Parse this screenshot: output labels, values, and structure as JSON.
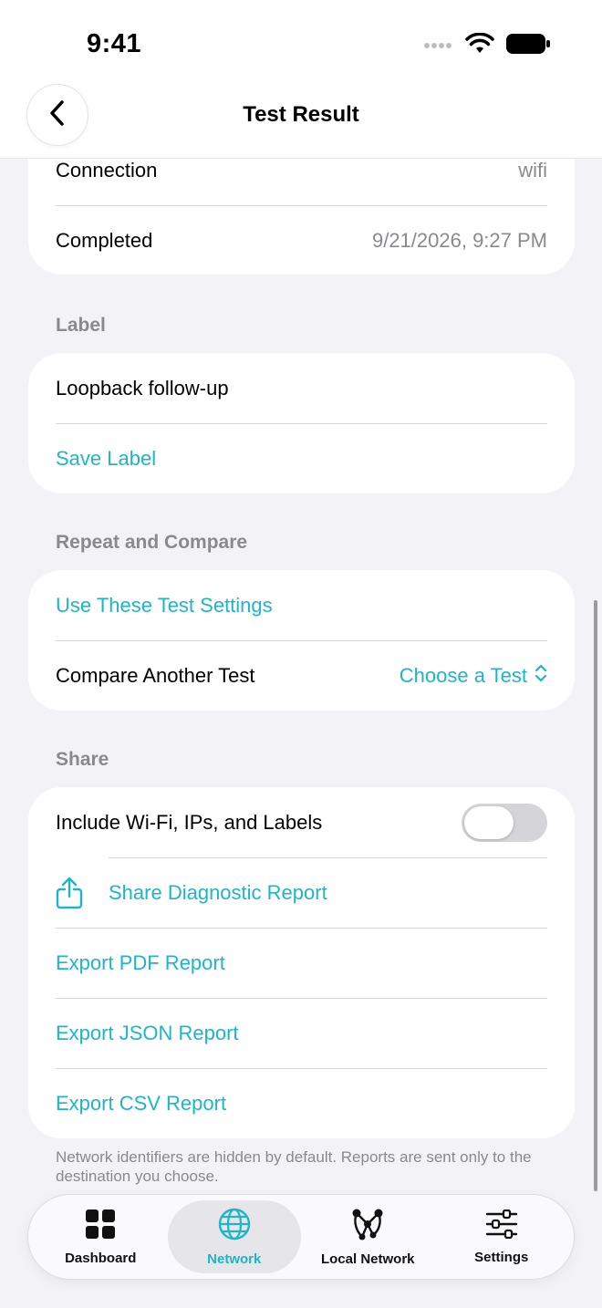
{
  "status": {
    "time": "9:41"
  },
  "nav": {
    "title": "Test Result"
  },
  "details": [
    {
      "label": "Connection",
      "value": "wifi"
    },
    {
      "label": "Completed",
      "value": "9/21/2026, 9:27 PM"
    }
  ],
  "label_section": {
    "header": "Label",
    "field_value": "Loopback follow-up",
    "save_label": "Save Label"
  },
  "repeat_section": {
    "header": "Repeat and Compare",
    "use_settings": "Use These Test Settings",
    "compare_label": "Compare Another Test",
    "compare_picker": "Choose a Test"
  },
  "share_section": {
    "header": "Share",
    "include_label": "Include Wi-Fi, IPs, and Labels",
    "include_on": false,
    "share_report": "Share Diagnostic Report",
    "export_pdf": "Export PDF Report",
    "export_json": "Export JSON Report",
    "export_csv": "Export CSV Report",
    "footnote": "Network identifiers are hidden by default. Reports are sent only to the destination you choose."
  },
  "tabs": [
    {
      "label": "Dashboard",
      "icon": "grid-icon"
    },
    {
      "label": "Network",
      "icon": "globe-icon"
    },
    {
      "label": "Local Network",
      "icon": "network-nodes-icon"
    },
    {
      "label": "Settings",
      "icon": "sliders-icon"
    }
  ],
  "colors": {
    "accent": "#1DB5C9",
    "background": "#F2F2F7",
    "secondary_text": "#8A8A8E"
  }
}
